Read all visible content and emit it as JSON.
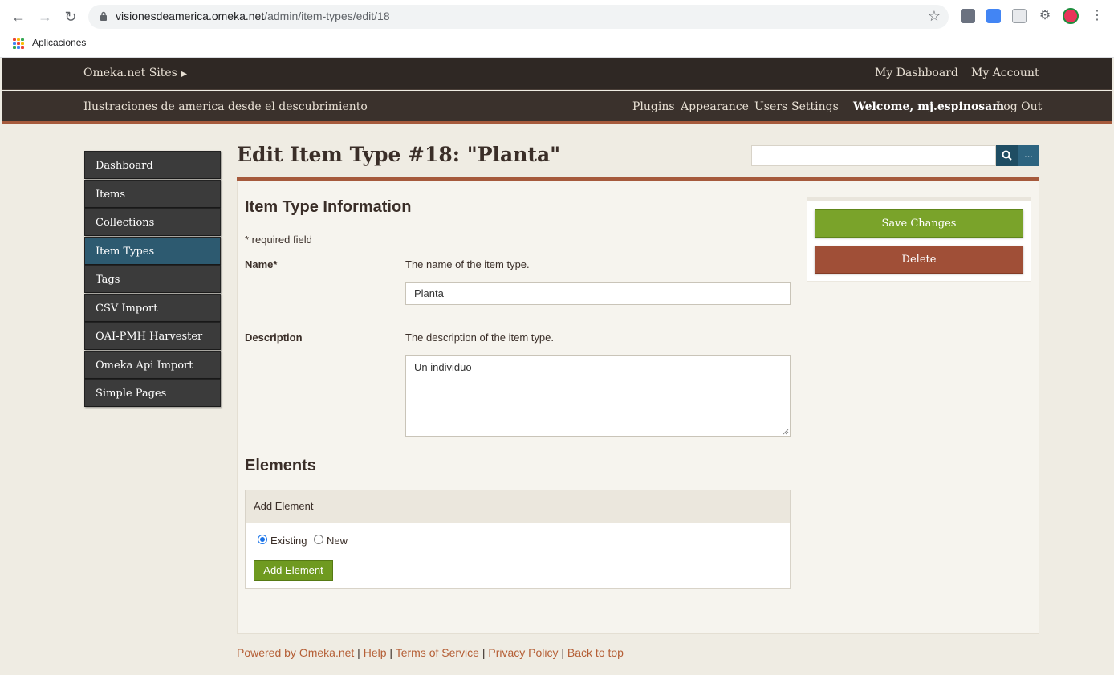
{
  "browser": {
    "url_host": "visionesdeamerica.omeka.net",
    "url_path": "/admin/item-types/edit/18",
    "bookmarks_label": "Aplicaciones"
  },
  "header": {
    "sites_label": "Omeka.net Sites",
    "my_dashboard": "My Dashboard",
    "my_account": "My Account",
    "site_title": "Ilustraciones de america desde el descubrimiento",
    "nav": [
      "Plugins",
      "Appearance",
      "Users",
      "Settings"
    ],
    "welcome": "Welcome, mj.espinosam",
    "logout": "Log Out"
  },
  "sidebar": {
    "items": [
      {
        "label": "Dashboard",
        "active": false
      },
      {
        "label": "Items",
        "active": false
      },
      {
        "label": "Collections",
        "active": false
      },
      {
        "label": "Item Types",
        "active": true
      },
      {
        "label": "Tags",
        "active": false
      },
      {
        "label": "CSV Import",
        "active": false
      },
      {
        "label": "OAI-PMH Harvester",
        "active": false
      },
      {
        "label": "Omeka Api Import",
        "active": false
      },
      {
        "label": "Simple Pages",
        "active": false
      }
    ]
  },
  "page": {
    "title": "Edit Item Type #18: \"Planta\"",
    "search_button": "🔍",
    "advanced_button": "..."
  },
  "form": {
    "section_title": "Item Type Information",
    "required_note": "* required field",
    "name_label": "Name*",
    "name_help": "The name of the item type.",
    "name_value": "Planta",
    "description_label": "Description",
    "description_help": "The description of the item type.",
    "description_value": "Un individuo"
  },
  "elements": {
    "section_title": "Elements",
    "box_title": "Add Element",
    "radio_existing": "Existing",
    "radio_new": "New",
    "selected": "Existing",
    "add_button": "Add Element"
  },
  "actions": {
    "save": "Save Changes",
    "delete": "Delete"
  },
  "footer": {
    "powered": "Powered by Omeka.net",
    "help": "Help",
    "terms": "Terms of Service",
    "privacy": "Privacy Policy",
    "back_to_top": "Back to top",
    "separator": " | "
  },
  "colors": {
    "accent": "#a65a3c",
    "save_green": "#7aa32a",
    "delete_red": "#a04f37",
    "active_nav": "#2d5a70"
  }
}
